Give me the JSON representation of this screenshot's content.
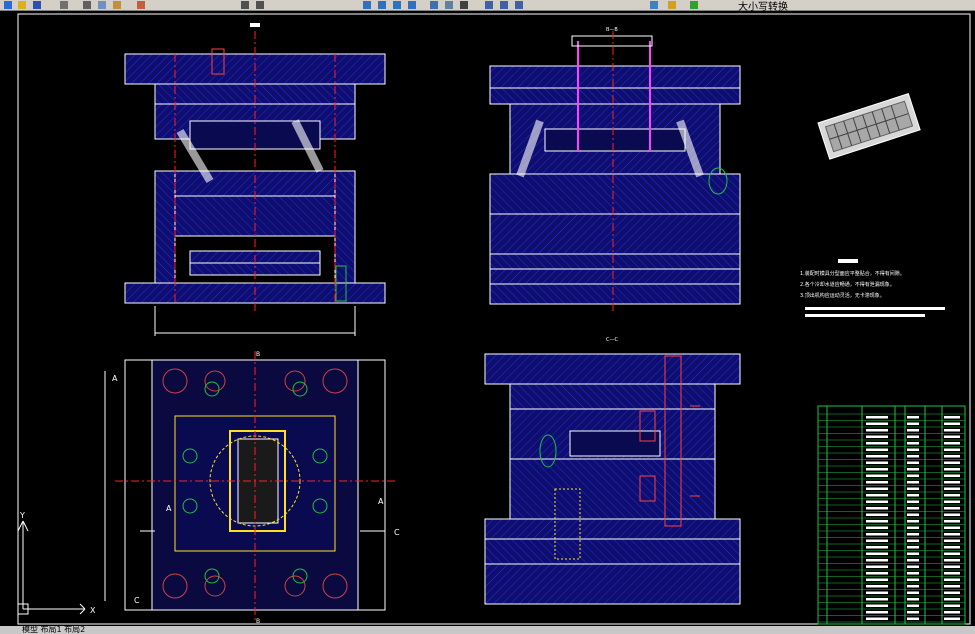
{
  "app": {
    "toolbar_title": "大小写转换",
    "status_text": "模型  布局1  布局2"
  },
  "toolbar_icons": [
    "arrow-icon",
    "open-icon",
    "save-icon",
    "print-icon",
    "cut-icon",
    "copy-icon",
    "paste-icon",
    "match-icon",
    "undo-icon",
    "redo-icon",
    "pan-icon",
    "zoom-icon",
    "zoom-window-icon",
    "zoom-previous-icon",
    "properties-icon",
    "design-center-icon",
    "tool-palette-icon",
    "text-style-icon",
    "dimension-style-icon",
    "table-style-icon",
    "layer-icon",
    "layer-state-icon",
    "color-icon"
  ],
  "drawing": {
    "view_labels": {
      "section_bb": "B—B",
      "section_cc": "C—C",
      "label_a_top": "A",
      "label_a_left": "A",
      "label_a_right": "A",
      "label_c_right": "C",
      "label_c_left": "C",
      "label_b_top": "B",
      "label_b_bottom": "B"
    },
    "ucs": {
      "x": "X",
      "y": "Y"
    },
    "title_top_view": "技术要求",
    "notes": [
      "1.装配时模具分型面应平整贴合，不得有间隙。",
      "2.各个冷却水道应畅通，不得有泄漏现象。",
      "3.顶出机构应运动灵活，无卡滞现象。",
      "4.",
      "5."
    ],
    "colors": {
      "plate_fill": "#0e0e6e",
      "outline": "#ffffff",
      "center_line": "#ff2020",
      "hatch": "#2a2ad8",
      "highlight_green": "#20c040",
      "highlight_yellow": "#ffe020",
      "highlight_magenta": "#ff40ff"
    }
  }
}
